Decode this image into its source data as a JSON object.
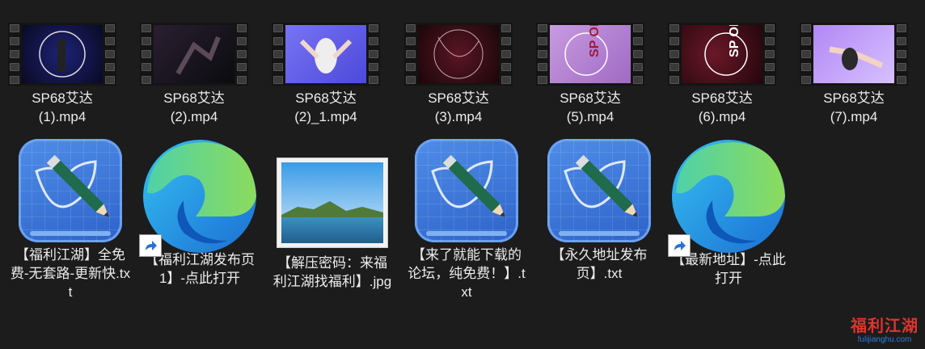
{
  "videos": [
    {
      "name": "SP68艾达\n(1).mp4",
      "line1": "SP68艾达",
      "line2": "(1).mp4",
      "bg1": "#1a1d6b",
      "bg2": "#0b0b2a"
    },
    {
      "name": "SP68艾达\n(2).mp4",
      "line1": "SP68艾达",
      "line2": "(2).mp4",
      "bg1": "#241a2a",
      "bg2": "#0c0c12"
    },
    {
      "name": "SP68艾达\n(2)_1.mp4",
      "line1": "SP68艾达",
      "line2": "(2)_1.mp4",
      "bg1": "#6f6cf0",
      "bg2": "#4c48d8"
    },
    {
      "name": "SP68艾达\n(3).mp4",
      "line1": "SP68艾达",
      "line2": "(3).mp4",
      "bg1": "#4a1420",
      "bg2": "#1a0609"
    },
    {
      "name": "SP68艾达\n(5).mp4",
      "line1": "SP68艾达",
      "line2": "(5).mp4",
      "bg1": "#a96fc9",
      "bg2": "#d9a7e6"
    },
    {
      "name": "SP68艾达\n(6).mp4",
      "line1": "SP68艾达",
      "line2": "(6).mp4",
      "bg1": "#5a1420",
      "bg2": "#25060b"
    },
    {
      "name": "SP68艾达\n(7).mp4",
      "line1": "SP68艾达",
      "line2": "(7).mp4",
      "bg1": "#a77cf0",
      "bg2": "#d2b7ff"
    }
  ],
  "files": [
    {
      "type": "txt",
      "label": "【福利江湖】全免费-无套路-更新快.txt"
    },
    {
      "type": "edge",
      "label": "【福利江湖发布页1】-点此打开"
    },
    {
      "type": "jpg",
      "label": "【解压密码：来福利江湖找福利】.jpg"
    },
    {
      "type": "txt",
      "label": "【来了就能下载的论坛，纯免费！】.txt"
    },
    {
      "type": "txt",
      "label": "【永久地址发布页】.txt"
    },
    {
      "type": "edge",
      "label": "【最新地址】-点此打开"
    }
  ],
  "watermark": {
    "title": "福利江湖",
    "url": "fulijianghu.com"
  },
  "colors": {
    "background": "#1c1c1c",
    "text": "#ececec",
    "accent": "#e0342c"
  }
}
